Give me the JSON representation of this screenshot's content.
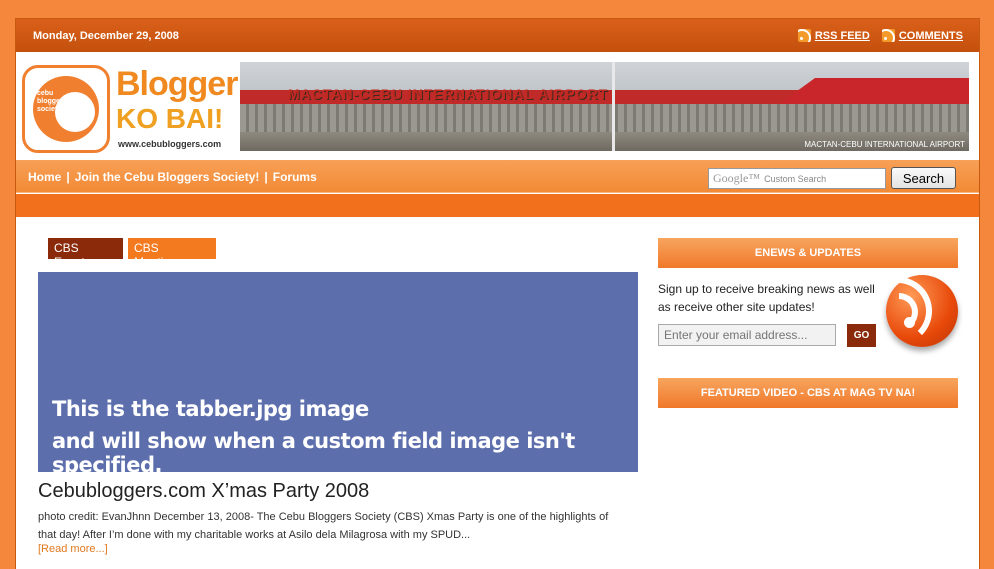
{
  "topbar": {
    "date": "Monday, December 29, 2008",
    "rss_label": "RSS FEED",
    "comments_label": "COMMENTS"
  },
  "header": {
    "logo_line1": "Blogger",
    "logo_line2": "KO BAI!",
    "logo_url": "www.cebubloggers.com",
    "logo_seal": "cebu bloggers society",
    "banner_sign": "MACTAN-CEBU INTERNATIONAL AIRPORT",
    "banner_caption": "MACTAN-CEBU INTERNATIONAL AIRPORT"
  },
  "nav": {
    "items": [
      "Home",
      "Join the Cebu Bloggers Society!",
      "Forums"
    ],
    "search_placeholder": "Custom Search",
    "google_mark": "Google™",
    "search_button": "Search"
  },
  "tags": [
    "CBS Events",
    "CBS Meetings"
  ],
  "feature": {
    "line1": "This is the tabber.jpg image",
    "line2": "and will show when a custom field image isn't specified."
  },
  "post": {
    "title": "Cebubloggers.com X’mas Party 2008",
    "excerpt": "photo credit: EvanJhnn December 13, 2008- The Cebu Bloggers Society (CBS) Xmas Party is one of the highlights of that day! After I’m done with my charitable works at Asilo dela Milagrosa with my SPUD...",
    "read_more": "[Read more...]"
  },
  "sidebar": {
    "enews_title": "ENEWS & UPDATES",
    "signup_text": "Sign up to receive breaking news as well as receive other site updates!",
    "email_placeholder": "Enter your email address...",
    "go_label": "GO",
    "video_title": "FEATURED VIDEO - CBS AT MAG TV NA!"
  },
  "colors": {
    "accent": "#f26f1c",
    "dark_accent": "#8a2a0a",
    "feature_bg": "#5d6ead"
  }
}
